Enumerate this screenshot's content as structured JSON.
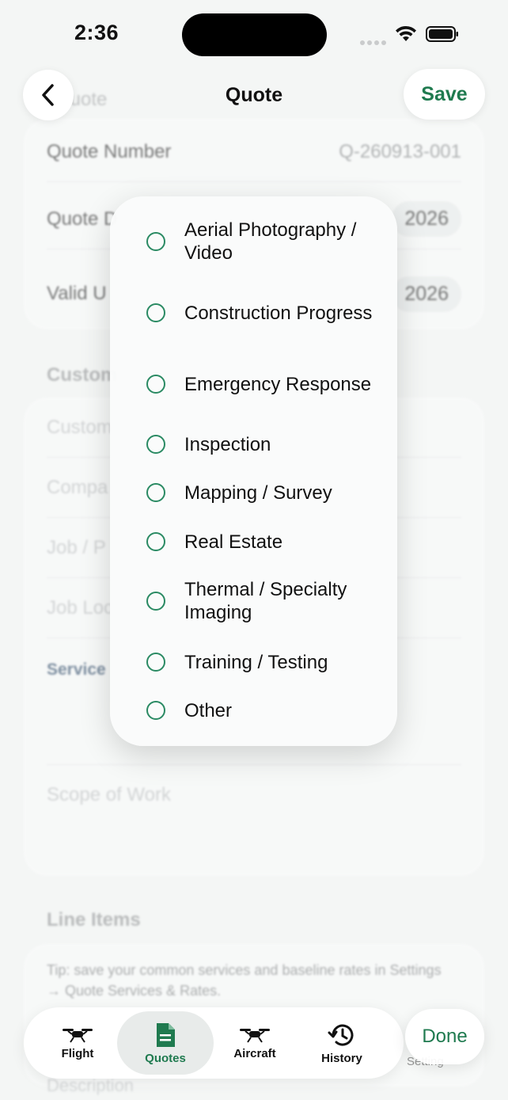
{
  "status_bar": {
    "time": "2:36"
  },
  "header": {
    "title": "Quote",
    "save_label": "Save",
    "back_icon": "chevron-left-icon",
    "ghost_title": "Quote"
  },
  "quote_card": {
    "quote_number_label": "Quote Number",
    "quote_number_value": "Q-260913-001",
    "quote_date_label": "Quote D",
    "quote_date_value": "2026",
    "valid_until_label": "Valid U",
    "valid_until_value": "2026"
  },
  "customer_section": {
    "title": "Custom",
    "fields": [
      "Custom",
      "Compa",
      "Job / P",
      "Job Loc"
    ],
    "service_label": "Service",
    "scope_placeholder": "Scope of Work"
  },
  "line_items": {
    "title": "Line Items",
    "tip": "Tip: save your common services and baseline rates in Settings → Quote Services & Rates.",
    "description_placeholder": "Description"
  },
  "service_menu": {
    "options": [
      "Aerial Photography / Video",
      "Construction Progress",
      "Emergency Response",
      "Inspection",
      "Mapping / Survey",
      "Real Estate",
      "Thermal / Specialty Imaging",
      "Training / Testing",
      "Other"
    ]
  },
  "tabbar": {
    "tabs": [
      {
        "label": "Flight",
        "icon": "drone-icon"
      },
      {
        "label": "Quotes",
        "icon": "document-icon"
      },
      {
        "label": "Aircraft",
        "icon": "drone-icon"
      },
      {
        "label": "History",
        "icon": "history-icon"
      }
    ],
    "active": "Quotes",
    "settings_ghost": "Setting"
  },
  "done_label": "Done",
  "colors": {
    "accent": "#1f7a4f",
    "radio": "#2a8a63",
    "service_label": "#1d3b5c"
  }
}
